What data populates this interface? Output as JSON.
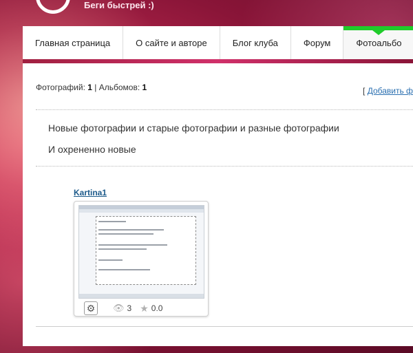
{
  "header": {
    "slogan": "Беги быстрей :)"
  },
  "nav": {
    "items": [
      {
        "label": "Главная страница"
      },
      {
        "label": "О сайте и авторе"
      },
      {
        "label": "Блог клуба"
      },
      {
        "label": "Форум"
      },
      {
        "label": "Фотоальбо"
      }
    ],
    "active_index": 4
  },
  "stats": {
    "photos_label": "Фотографий:",
    "photos_count": "1",
    "separator": "|",
    "albums_label": "Альбомов:",
    "albums_count": "1"
  },
  "add_link": {
    "bracket": "[",
    "label": "Добавить ф"
  },
  "description": {
    "line1": "Новые фотографии и старые фотографии и разные фотографии",
    "line2": "И охрененно новые"
  },
  "album": {
    "title": "Kartina1",
    "views": "3",
    "rating": "0.0",
    "icons": {
      "settings": "gear-icon",
      "views": "eye-icon",
      "rating": "star-icon"
    }
  },
  "colors": {
    "accent_green": "#1fcc2a",
    "link_blue": "#2a6fb0",
    "brand_pink": "#b8284e"
  }
}
